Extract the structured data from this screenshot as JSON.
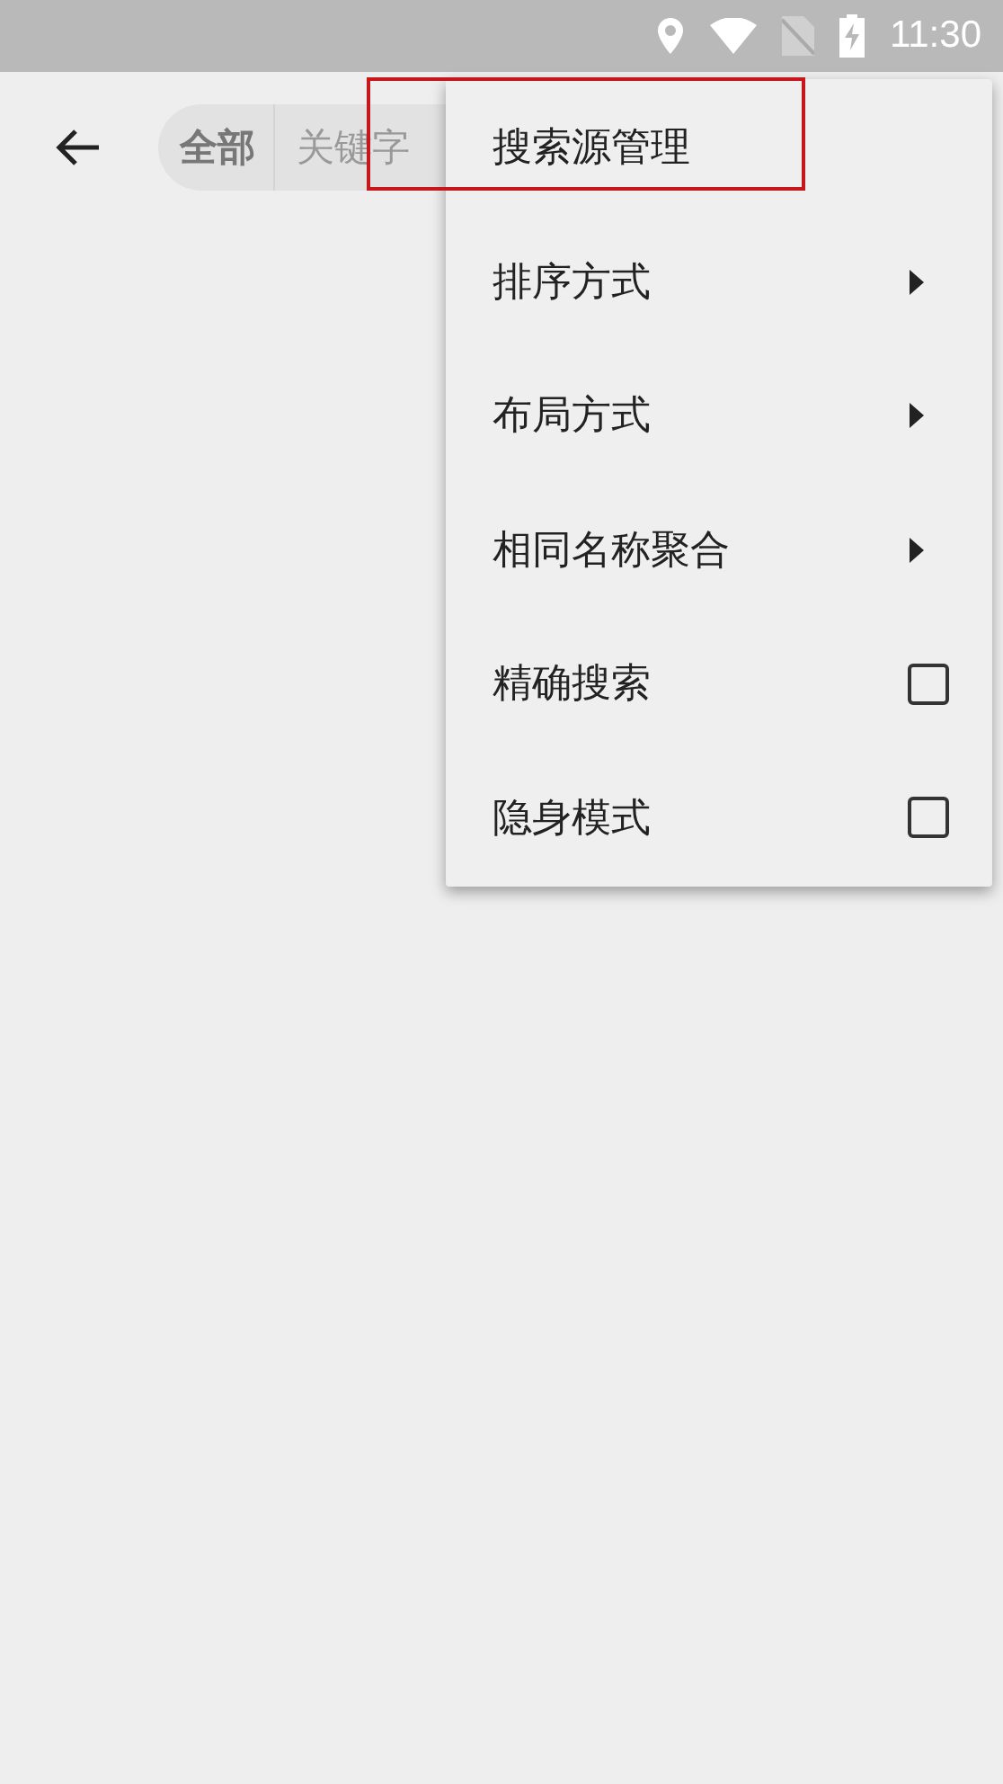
{
  "status_bar": {
    "time": "11:30"
  },
  "toolbar": {
    "scope": "全部",
    "search": {
      "placeholder": "关键字"
    }
  },
  "menu": {
    "items": [
      {
        "kind": "action",
        "label": "搜索源管理",
        "highlighted": true
      },
      {
        "kind": "submenu",
        "label": "排序方式",
        "highlighted": false
      },
      {
        "kind": "submenu",
        "label": "布局方式",
        "highlighted": false
      },
      {
        "kind": "submenu",
        "label": "相同名称聚合",
        "highlighted": false
      },
      {
        "kind": "checkbox",
        "label": "精确搜索",
        "checked": false,
        "highlighted": false
      },
      {
        "kind": "checkbox",
        "label": "隐身模式",
        "checked": false,
        "highlighted": false
      }
    ]
  }
}
